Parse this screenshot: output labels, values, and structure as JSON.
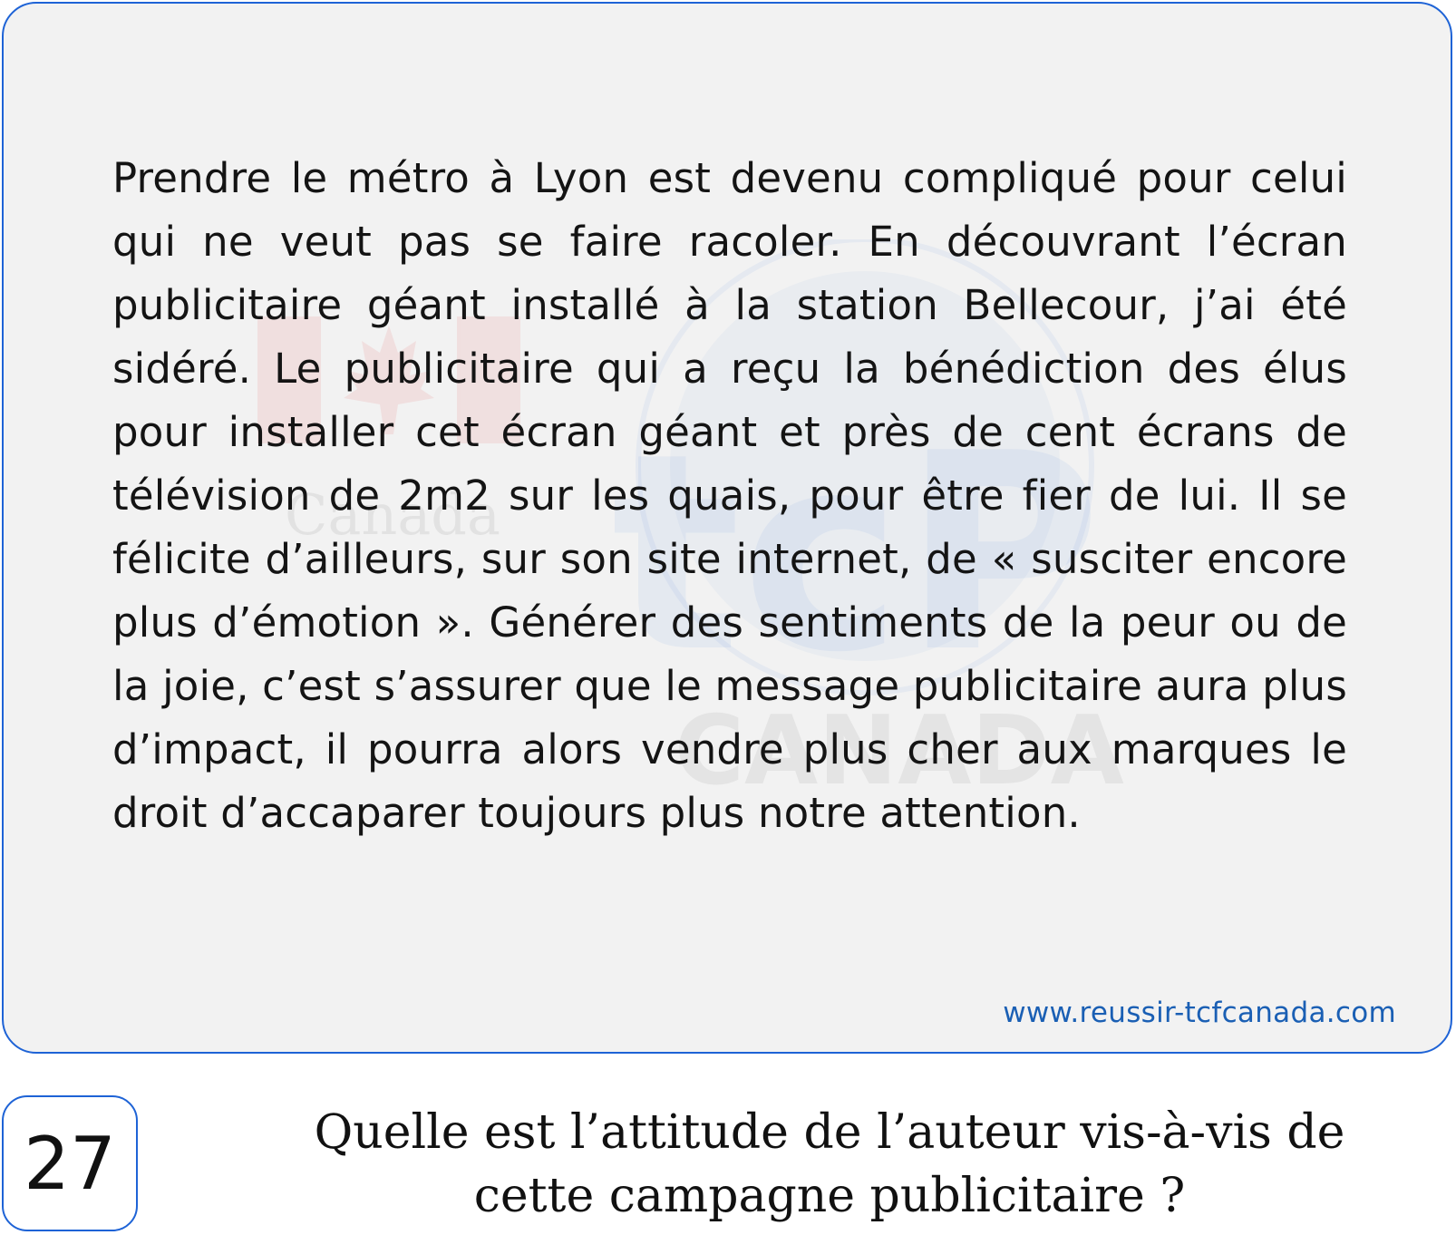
{
  "passage": {
    "text": "Prendre le métro à Lyon est devenu compliqué pour celui qui ne veut pas se faire racoler. En découvrant l’écran publicitaire géant installé à la station Bellecour, j’ai été sidéré. Le publicitaire qui a reçu la bénédiction des élus pour installer cet écran géant et près de cent écrans de télévision de 2m2 sur les quais, pour être fier de lui. Il se félicite d’ailleurs, sur son site internet, de « susciter encore plus d’émotion ». Générer des sentiments de la peur ou de la joie, c’est s’assurer que le message publicitaire aura plus d’impact, il pourra alors vendre plus cher aux marques le droit d’accaparer toujours plus notre attention."
  },
  "watermark": {
    "canada_word": "Canada",
    "brand": "tcP",
    "country": "CANADA",
    "ring_text": "TCF CANADA"
  },
  "footer": {
    "url": "www.reussir-tcfcanada.com"
  },
  "question": {
    "number": "27",
    "text": "Quelle est l’attitude de l’auteur vis-à-vis de cette campagne publicitaire ?"
  },
  "colors": {
    "border": "#1e63d6",
    "card_bg": "#f2f2f2",
    "url": "#1a5fb4",
    "flag_red": "#e0282c",
    "watermark_blue": "#1e63d6"
  }
}
